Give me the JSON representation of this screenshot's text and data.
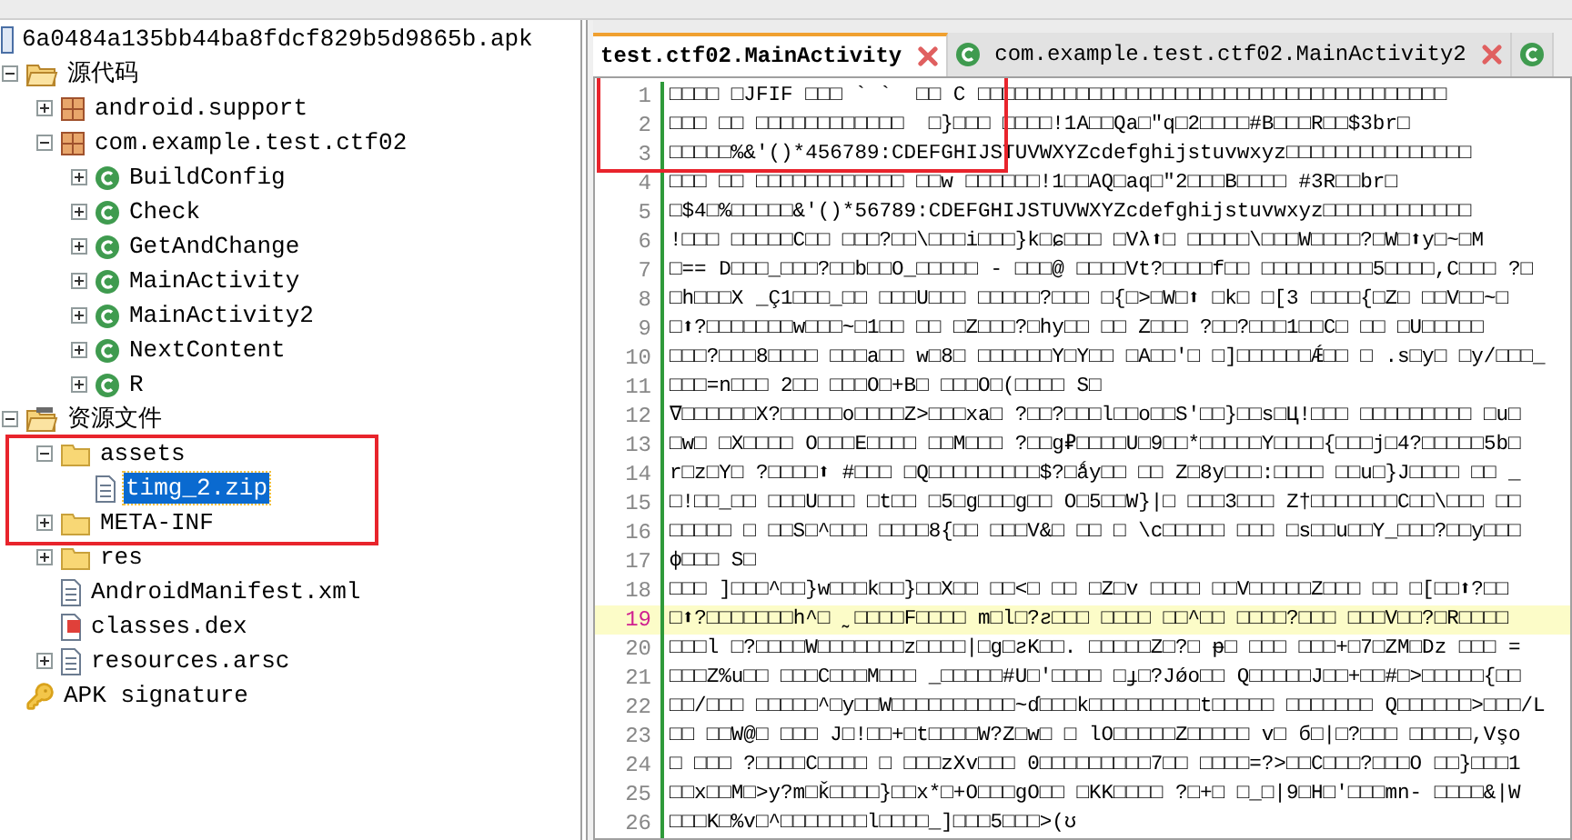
{
  "tree": {
    "label": "6a0484a135bb44ba8fdcf829b5d9865b.apk",
    "kind": "apk",
    "selected": false,
    "children": [
      {
        "label": "源代码",
        "kind": "source-folder",
        "expanded": true,
        "selected": false,
        "children": [
          {
            "label": "android.support",
            "kind": "package",
            "expanded": false,
            "selected": false
          },
          {
            "label": "com.example.test.ctf02",
            "kind": "package",
            "expanded": true,
            "selected": false,
            "children": [
              {
                "label": "BuildConfig",
                "kind": "class",
                "expanded": false,
                "selected": false
              },
              {
                "label": "Check",
                "kind": "class",
                "expanded": false,
                "selected": false
              },
              {
                "label": "GetAndChange",
                "kind": "class",
                "expanded": false,
                "selected": false
              },
              {
                "label": "MainActivity",
                "kind": "class",
                "expanded": false,
                "selected": false
              },
              {
                "label": "MainActivity2",
                "kind": "class",
                "expanded": false,
                "selected": false
              },
              {
                "label": "NextContent",
                "kind": "class",
                "expanded": false,
                "selected": false
              },
              {
                "label": "R",
                "kind": "class",
                "expanded": false,
                "selected": false
              }
            ]
          }
        ]
      },
      {
        "label": "资源文件",
        "kind": "resource-folder",
        "expanded": true,
        "selected": false,
        "children": [
          {
            "label": "assets",
            "kind": "folder",
            "expanded": true,
            "selected": false,
            "children": [
              {
                "label": "timg_2.zip",
                "kind": "file",
                "selected": true
              }
            ]
          },
          {
            "label": "META-INF",
            "kind": "folder",
            "expanded": false,
            "selected": false
          },
          {
            "label": "res",
            "kind": "folder",
            "expanded": false,
            "selected": false
          },
          {
            "label": "AndroidManifest.xml",
            "kind": "file",
            "selected": false
          },
          {
            "label": "classes.dex",
            "kind": "dex",
            "selected": false
          },
          {
            "label": "resources.arsc",
            "kind": "file",
            "expanded": false,
            "selected": false
          }
        ]
      },
      {
        "label": "APK signature",
        "kind": "key",
        "selected": false
      }
    ]
  },
  "tabs": [
    {
      "label": "test.ctf02.MainActivity",
      "kind": "plain",
      "selected": true
    },
    {
      "label": "com.example.test.ctf02.MainActivity2",
      "kind": "class",
      "selected": false
    },
    {
      "kind": "class",
      "selected": false
    }
  ],
  "editor": {
    "lines": [
      {
        "number": "1",
        "text": "□□□□ □JFIF □□□ ` `  □□ C □□□□□□□□□□□□□□□□□□□□□□□□□□□□□□□□□□□□□□",
        "current": false
      },
      {
        "number": "2",
        "text": "□□□ □□ □□□□□□□□□□□□  □}□□□ □□□□!1A□□Qa□\"q□2□□□□#B□□□R□□$3br□",
        "current": false
      },
      {
        "number": "3",
        "text": "□□□□□%&'()*456789:CDEFGHIJSTUVWXYZcdefghijstuvwxyz□□□□□□□□□□□□□□□",
        "current": false
      },
      {
        "number": "4",
        "text": "□□□ □□ □□□□□□□□□□□□ □□w □□□□□□!1□□AQ□aq□\"2□□□B□□□□ #3R□□br□",
        "current": false
      },
      {
        "number": "5",
        "text": "□$4□%□□□□□&'()*56789:CDEFGHIJSTUVWXYZcdefghijstuvwxyz□□□□□□□□□□□□",
        "current": false
      },
      {
        "number": "6",
        "text": "!□□□ □□□□□C□□ □□□?□□\\□□□i□□□}k□ɕ□□□ □Vλ⬆□ □□□□□\\□□□W□□□□?□W□⬆y□~□M",
        "current": false
      },
      {
        "number": "7",
        "text": "□== D□□□_□□□?□□b□□O_□□□□□ - □□□@ □□□□Vt?□□□□f□□ □□□□□□□□□5□□□□,C□□□ ?□",
        "current": false
      },
      {
        "number": "8",
        "text": "□h□□□X _Ç1□□□_□□ □□□U□□□ □□□□□?□□□ □{□>□W□⬆ □k□ □[3 □□□□{□Z□ □□V□□~□",
        "current": false
      },
      {
        "number": "9",
        "text": "□⬆?□□□□□□□w□□□~□1□□ □□ □Z□□□?□hy□□ □□ Z□□□ ?□□?□□□1□□C□ □□ □U□□□□□",
        "current": false
      },
      {
        "number": "10",
        "text": "□□□?□□□8□□□□ □□□a□□ w□8□ □□□□□□Y□Y□□ □A□□'□ □]□□□□□□Ǽ□□ □ .s□y□ □y/□□□_",
        "current": false
      },
      {
        "number": "11",
        "text": "□□□=n□□□ 2□□ □□□O□+B□ □□□O□(□□□□ S□",
        "current": false
      },
      {
        "number": "12",
        "text": "∇□□□□□□X?□□□□□o□□□□Z>□□□xa□ ?□□?□□□l□□o□□S'□□}□□s□Ц!□□□ □□□□□□□□□ □u□",
        "current": false
      },
      {
        "number": "13",
        "text": "□w□ □X□□□□ O□□□E□□□□ □□M□□□ ?□□g₽□□□□U□9□□*□□□□□Y□□□□{□□□j□4?□□□□□5b□",
        "current": false
      },
      {
        "number": "14",
        "text": "r□z□Y□ ?□□□□⬆ #□□□ □Q□□□□□□□□□$?□ǻy□□ □□ Z□8y□□□:□□□□ □□u□}J□□□□ □□ _",
        "current": false
      },
      {
        "number": "15",
        "text": "□!□□_□□ □□□U□□□ □t□□ □5□g□□□g□□ O□5□□W}|□ □□□3□□□ Z†□□□□□□□C□□\\□□□ □□",
        "current": false
      },
      {
        "number": "16",
        "text": "□□□□□ □ □□S□^□□□ □□□□8{□□ □□□V&□ □□ □ \\c□□□□□ □□□ □s□□u□□Y_□□□?□□y□□□",
        "current": false
      },
      {
        "number": "17",
        "text": "ф□□□ S□",
        "current": false
      },
      {
        "number": "18",
        "text": "□□□ ]□□□^□□}w□□□k□□}□□X□□ □□<□ □□ □Z□v □□□□ □□V□□□□□Z□□□ □□ □[□□⬆?□□",
        "current": false
      },
      {
        "number": "19",
        "text": "□⬆?□□□□□□□h^□ ˷□□□□F□□□□ m□l□?ƨ□□□ □□□□ □□^□□ □□□□?□□□ □□□V□□?□R□□□□",
        "current": true
      },
      {
        "number": "20",
        "text": "□□□l □?□□□□W□□□□□□□z□□□□|□g□ƨK□□. □□□□□Z□?□ ᵽ□ □□□ □□□+□7□ZM□Dz □□□ =",
        "current": false
      },
      {
        "number": "21",
        "text": "□□□Z%u□□ □□□C□□□M□□□ _□□□□□#U□'□□□□ □ɟ□?Jǿo□□ Q□□□□□J□□+□□#□>□□□□□{□□",
        "current": false
      },
      {
        "number": "22",
        "text": "□□/□□□ □□□□□^□y□□W□□□□□□□□□□~ɗ□□□k□□□□□□□□□t□□□□□ □□□□□□□ Q□□□□□□>□□□/L",
        "current": false
      },
      {
        "number": "23",
        "text": "□□ □□W@□ □□□ J□!□□+□t□□□□W?Z□w□ □ lO□□□□□Z□□□□□ v□ б□|□?□□□ □□□□□,Vşo",
        "current": false
      },
      {
        "number": "24",
        "text": "□ □□□ ?□□□□C□□□□ □ □□□zXv□□□ 0□□□□□□□□□7□□ □□□□=?>□□C□□□?□□□O □□}□□□1",
        "current": false
      },
      {
        "number": "25",
        "text": "□□x□□M□>y?m□ǩ□□□□}□□x*□+O□□□gO□□ □KK□□□□ ?□+□ □_□|9□H□'□□□mn- □□□□&|W",
        "current": false
      },
      {
        "number": "26",
        "text": "□□□K□%v□^□□□□□□□l□□□□_]□□□5□□□>(ʊ",
        "current": false
      }
    ]
  }
}
